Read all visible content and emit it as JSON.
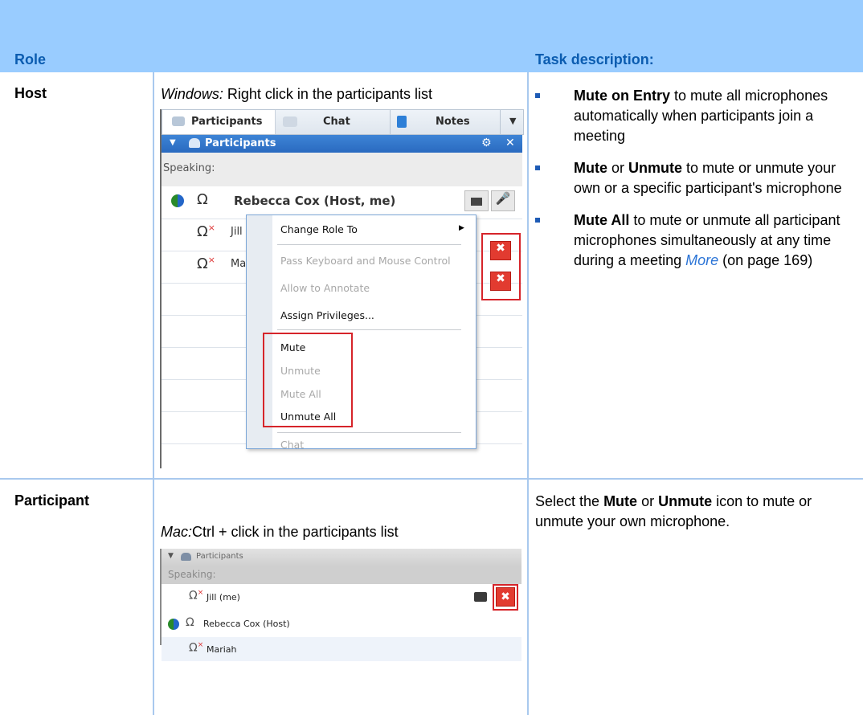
{
  "table": {
    "header_role": "Role",
    "header_task": "Task description:"
  },
  "rows": {
    "host": {
      "role": "Host",
      "platform": "Windows:",
      "instruction": " Right click in the participants list",
      "bullets": [
        {
          "bold": "Mute on Entry",
          "text": " to mute all microphones automatically when participants join a meeting"
        },
        {
          "bold1": "Mute",
          "mid": " or ",
          "bold2": "Unmute",
          "text": " to mute or unmute your own or a specific participant's microphone"
        },
        {
          "bold": "Mute All",
          "text": " to mute or unmute all participant microphones simultaneously at any time during a meeting ",
          "link": "More",
          "after": " (on page 169)"
        }
      ]
    },
    "participant": {
      "role": "Participant",
      "platform": "Mac:",
      "instruction": "Ctrl + click in the participants list",
      "desc_pre": "Select the ",
      "desc_b1": "Mute",
      "desc_mid": " or ",
      "desc_b2": "Unmute",
      "desc_post": " icon to mute or unmute your own microphone."
    }
  },
  "windows_panel": {
    "tabs": [
      "Participants",
      "Chat",
      "Notes"
    ],
    "panel_title": "Participants",
    "speaking": "Speaking:",
    "participants": [
      "Rebecca Cox (Host, me)",
      "Jill",
      "Ma"
    ],
    "menu": {
      "items": [
        {
          "label": "Change Role To",
          "enabled": true,
          "submenu": true
        },
        {
          "label": "Pass Keyboard and Mouse Control",
          "enabled": false
        },
        {
          "label": "Allow to Annotate",
          "enabled": false
        },
        {
          "label": "Assign Privileges...",
          "enabled": true
        },
        {
          "label": "Mute",
          "enabled": true
        },
        {
          "label": "Unmute",
          "enabled": false
        },
        {
          "label": "Mute All",
          "enabled": false
        },
        {
          "label": "Unmute All",
          "enabled": true
        },
        {
          "label": "Chat",
          "enabled": false
        }
      ]
    }
  },
  "mac_panel": {
    "title": "Participants",
    "speaking": "Speaking:",
    "participants": [
      "Jill (me)",
      "Rebecca Cox (Host)",
      "Mariah"
    ]
  },
  "colors": {
    "header_band": "#99ccff",
    "header_text": "#0b5cb0",
    "bullet": "#1e5bb5",
    "link": "#2b74d6",
    "highlight_box": "#d6242a"
  }
}
